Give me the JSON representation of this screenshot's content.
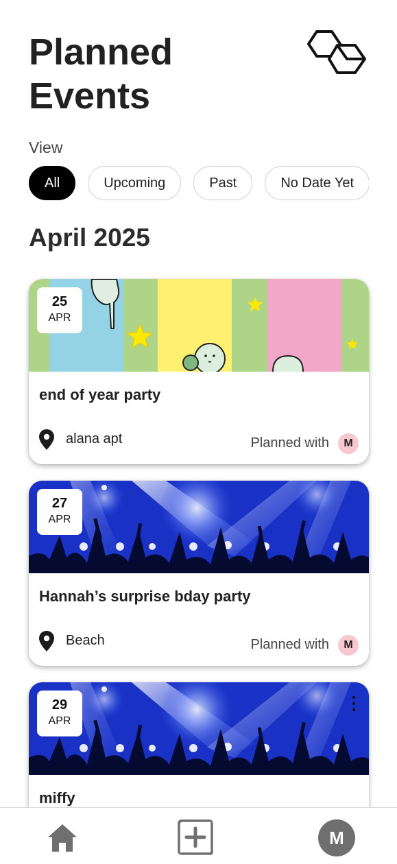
{
  "header": {
    "title": "Planned Events",
    "logo_icon": "hexagon-logo-icon"
  },
  "filters": {
    "label": "View",
    "options": [
      "All",
      "Upcoming",
      "Past",
      "No Date Yet"
    ],
    "selected": "All"
  },
  "month_heading": "April 2025",
  "events": [
    {
      "day": "25",
      "month": "APR",
      "title": "end of year party",
      "location": "alana apt",
      "planned_label": "Planned with",
      "planned_with_initial": "M",
      "image": "colorful-stripes-cartoon-image"
    },
    {
      "day": "27",
      "month": "APR",
      "title": "Hannah’s surprise bday party",
      "location": "Beach",
      "planned_label": "Planned with",
      "planned_with_initial": "M",
      "image": "concert-crowd-image"
    },
    {
      "day": "29",
      "month": "APR",
      "title": "miffy",
      "image": "concert-crowd-image",
      "menu_icon": "more-vertical-icon"
    }
  ],
  "bottom_nav": {
    "home_icon": "home-icon",
    "add_icon": "add-square-icon",
    "profile_initial": "M"
  },
  "colors": {
    "selected_chip": "#000000",
    "avatar_small": "#f7c8d0",
    "avatar_profile": "#6f6f6f",
    "concert_blue": "#1a3ad0"
  }
}
